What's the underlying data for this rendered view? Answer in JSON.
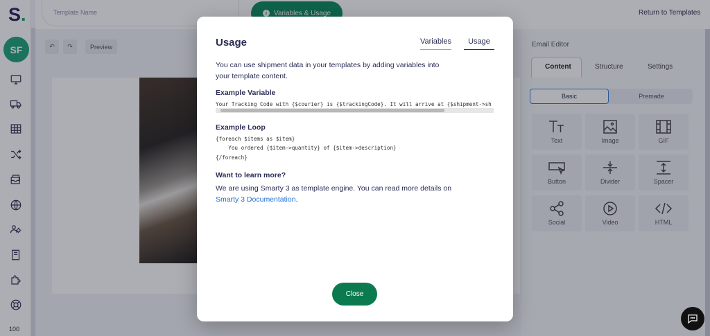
{
  "app": {
    "logo_letter": "S",
    "logo_dot": ".",
    "avatar_initials": "SF",
    "zoom_level": "100"
  },
  "topbar": {
    "template_name_placeholder": "Template Name",
    "variables_button": "Variables & Usage",
    "return_link": "Return to Templates"
  },
  "toolbar": {
    "preview_label": "Preview"
  },
  "sidebar": {
    "items": [
      "monitor-icon",
      "truck-icon",
      "table-icon",
      "shuffle-icon",
      "inbox-icon",
      "globe-icon",
      "users-settings-icon",
      "book-icon",
      "puzzle-icon",
      "support-icon"
    ]
  },
  "editor": {
    "title": "Email Editor",
    "tabs": [
      "Content",
      "Structure",
      "Settings"
    ],
    "segments": [
      "Basic",
      "Premade"
    ],
    "tiles": [
      "Text",
      "Image",
      "GIF",
      "Button",
      "Divider",
      "Spacer",
      "Social",
      "Video",
      "HTML"
    ]
  },
  "modal": {
    "title": "Usage",
    "tabs": [
      "Variables",
      "Usage"
    ],
    "intro": "You can use shipment data in your templates by adding variables into your template content.",
    "example_variable_heading": "Example Variable",
    "example_variable_code": "Your Tracking Code with {$courier} is {$trackingCode}. It will arrive at {$shipment->sh",
    "example_loop_heading": "Example Loop",
    "loop_line1": "{foreach $items as $item}",
    "loop_line2": "    You ordered {$item->quantity} of {$item->description}",
    "loop_line3": "{/foreach}",
    "learn_heading": "Want to learn more?",
    "learn_text": "We are using Smarty 3 as template engine. You can read more details on",
    "learn_link": "Smarty 3 Documentation",
    "learn_period": ".",
    "close_label": "Close"
  },
  "colors": {
    "accent": "#0f8d5f",
    "link": "#1f6fd1",
    "text": "#2a2d55"
  }
}
